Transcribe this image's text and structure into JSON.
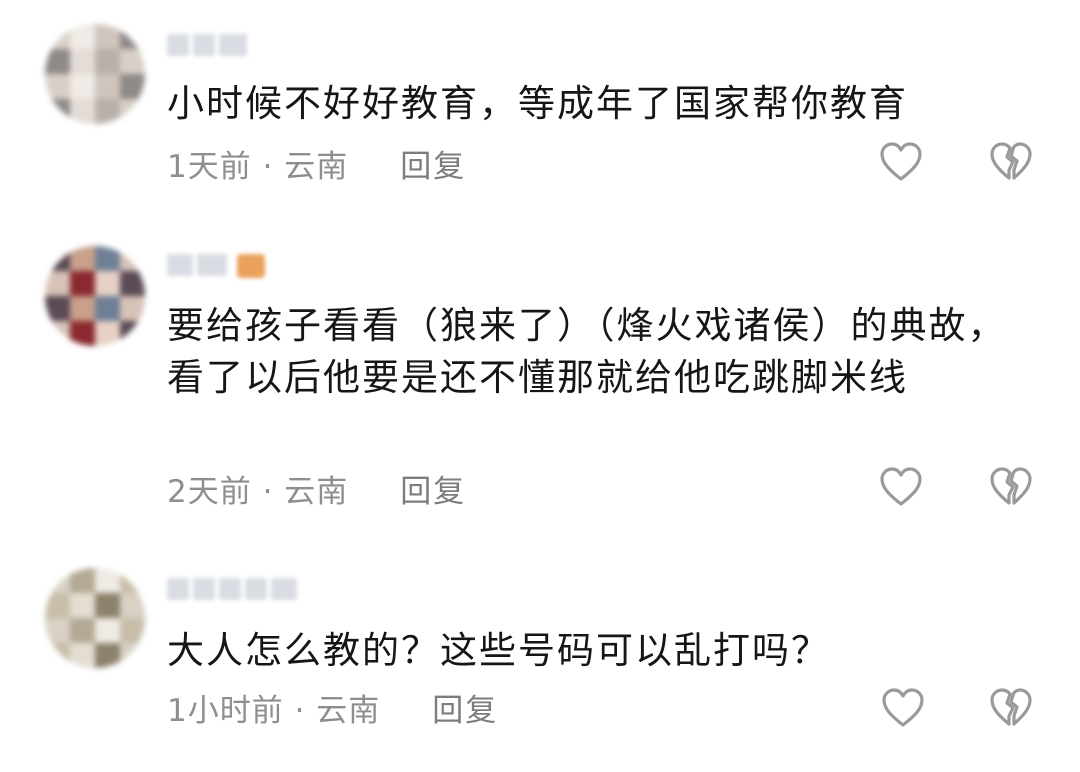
{
  "comments": [
    {
      "time_location": "1天前 · 云南",
      "reply_label": "回复",
      "text": "小时候不好好教育，等成年了国家帮你教育",
      "avatar_palette": [
        "#d8cfc7",
        "#b9b0ab",
        "#e4dcd6",
        "#8f8a88",
        "#cfc5bd",
        "#f0ebe6"
      ]
    },
    {
      "time_location": "2天前 · 云南",
      "reply_label": "回复",
      "text": "要给孩子看看（狼来了）（烽火戏诸侯）的典故，看了以后他要是还不懂那就给他吃跳脚米线",
      "avatar_palette": [
        "#c9a08a",
        "#5a4b55",
        "#e7d1c6",
        "#8a2a30",
        "#d7c2b8",
        "#6f7f96"
      ]
    },
    {
      "time_location": "1小时前 · 云南",
      "reply_label": "回复",
      "text": "大人怎么教的？这些号码可以乱打吗？",
      "avatar_palette": [
        "#efeae4",
        "#b3a994",
        "#d8d1c4",
        "#8d826b",
        "#e4ddd2",
        "#c7bda9"
      ]
    }
  ],
  "icons": {
    "like": "heart-outline-icon",
    "dislike": "broken-heart-outline-icon"
  },
  "colors": {
    "text": "#161616",
    "meta": "#8e8e8e",
    "icon_stroke": "#9a9a9a"
  }
}
